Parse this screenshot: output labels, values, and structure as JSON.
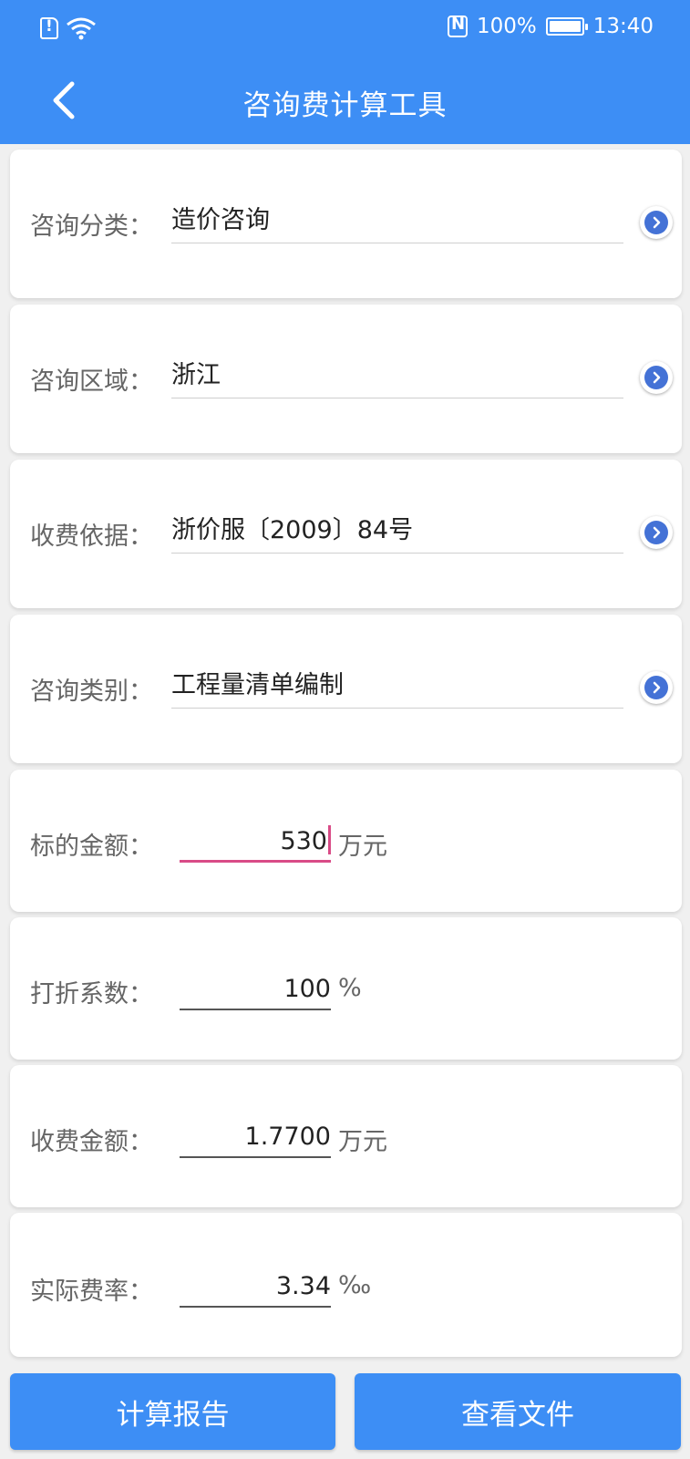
{
  "status_bar": {
    "battery": "100%",
    "time": "13:40"
  },
  "header": {
    "title": "咨询费计算工具"
  },
  "selects": [
    {
      "label": "咨询分类：",
      "value": "造价咨询"
    },
    {
      "label": "咨询区域：",
      "value": "浙江"
    },
    {
      "label": "收费依据：",
      "value": "浙价服〔2009〕84号"
    },
    {
      "label": "咨询类别：",
      "value": "工程量清单编制"
    }
  ],
  "fields": [
    {
      "label": "标的金额：",
      "value": "530",
      "unit": "万元"
    },
    {
      "label": "打折系数：",
      "value": "100",
      "unit": "%"
    },
    {
      "label": "收费金额：",
      "value": "1.7700",
      "unit": "万元"
    },
    {
      "label": "实际费率：",
      "value": "3.34",
      "unit": "‰"
    }
  ],
  "buttons": {
    "report": "计算报告",
    "files": "查看文件"
  },
  "colors": {
    "primary": "#3d8ef5",
    "accent_underline": "#d94b87",
    "arrow": "#4472d6"
  }
}
